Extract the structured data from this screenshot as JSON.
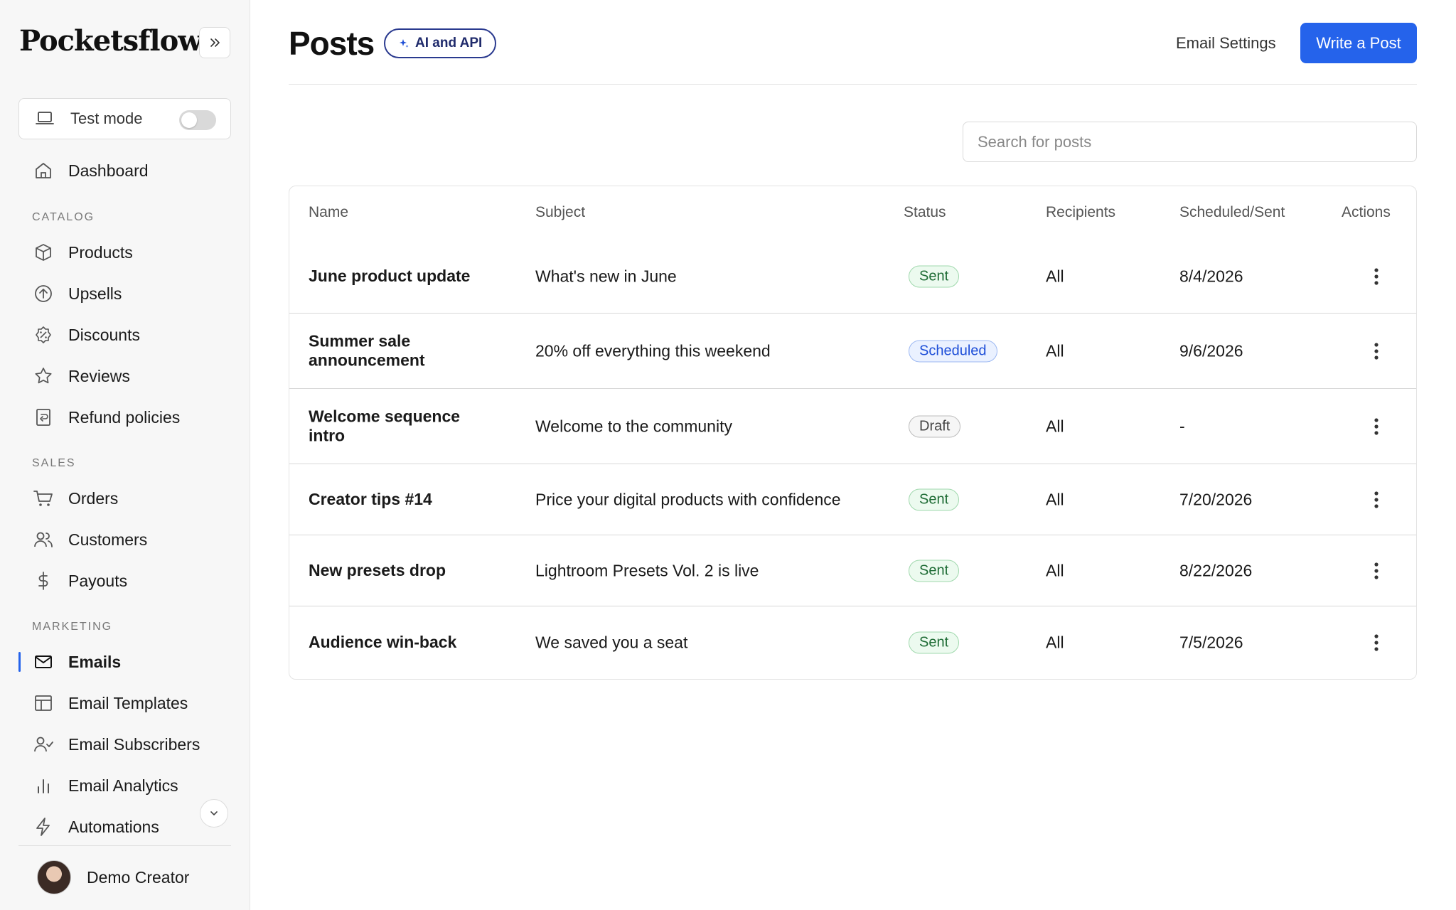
{
  "app": {
    "brand": "Pocketsflow"
  },
  "sidebar": {
    "test_mode_label": "Test mode",
    "dashboard": "Dashboard",
    "sections": {
      "catalog": "CATALOG",
      "sales": "SALES",
      "marketing": "MARKETING"
    },
    "catalog_items": [
      "Products",
      "Upsells",
      "Discounts",
      "Reviews",
      "Refund policies"
    ],
    "sales_items": [
      "Orders",
      "Customers",
      "Payouts"
    ],
    "marketing_items": [
      "Emails",
      "Email Templates",
      "Email Subscribers",
      "Email Analytics",
      "Automations"
    ],
    "active_item": "Emails",
    "user_name": "Demo Creator"
  },
  "header": {
    "title": "Posts",
    "ai_badge": "AI and API",
    "email_settings": "Email Settings",
    "write_button": "Write a Post"
  },
  "search": {
    "placeholder": "Search for posts",
    "value": ""
  },
  "table": {
    "columns": [
      "Name",
      "Subject",
      "Status",
      "Recipients",
      "Scheduled/Sent",
      "Actions"
    ],
    "rows": [
      {
        "name": "June product update",
        "subject": "What's new in June",
        "status": "Sent",
        "recipients": "All",
        "date": "8/4/2026"
      },
      {
        "name": "Summer sale announcement",
        "subject": "20% off everything this weekend",
        "status": "Scheduled",
        "recipients": "All",
        "date": "9/6/2026"
      },
      {
        "name": "Welcome sequence intro",
        "subject": "Welcome to the community",
        "status": "Draft",
        "recipients": "All",
        "date": "-"
      },
      {
        "name": "Creator tips #14",
        "subject": "Price your digital products with confidence",
        "status": "Sent",
        "recipients": "All",
        "date": "7/20/2026"
      },
      {
        "name": "New presets drop",
        "subject": "Lightroom Presets Vol. 2 is live",
        "status": "Sent",
        "recipients": "All",
        "date": "8/22/2026"
      },
      {
        "name": "Audience win-back",
        "subject": "We saved you a seat",
        "status": "Sent",
        "recipients": "All",
        "date": "7/5/2026"
      }
    ]
  },
  "colors": {
    "accent": "#2563eb",
    "sent": "#1d6b34",
    "scheduled": "#1d4ed8",
    "draft": "#444444"
  }
}
